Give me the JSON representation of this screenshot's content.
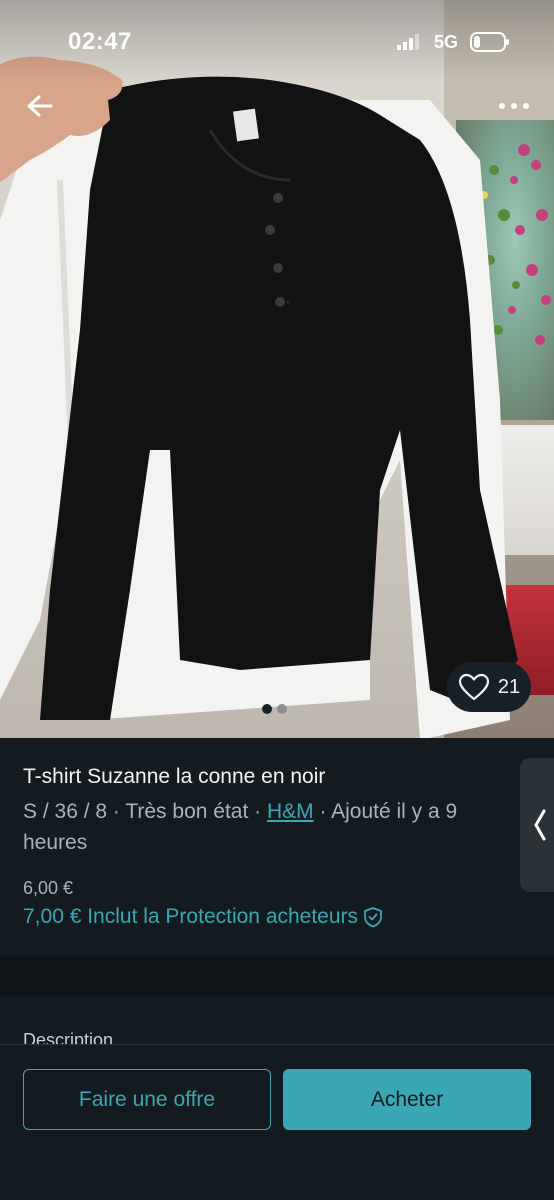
{
  "status_bar": {
    "time": "02:47",
    "network": "5G"
  },
  "photo": {
    "like_count": "21",
    "carousel_total": 2,
    "carousel_active": 1
  },
  "item": {
    "title": "T-shirt Suzanne la conne en noir",
    "meta_prefix": "S / 36 / 8 · Très bon état · ",
    "brand": "H&M",
    "meta_suffix": " · Ajouté il y a 9 heures",
    "price": "6,00 €",
    "total_price": "7,00 € Inclut la Protection acheteurs"
  },
  "description": {
    "label": "Description"
  },
  "actions": {
    "offer_label": "Faire une offre",
    "buy_label": "Acheter"
  },
  "colors": {
    "accent": "#39a7b4",
    "background": "#141b20"
  },
  "icons": [
    "back-arrow-icon",
    "more-icon",
    "heart-icon",
    "shield-check-icon",
    "chevron-left-icon",
    "signal-icon",
    "battery-icon"
  ]
}
